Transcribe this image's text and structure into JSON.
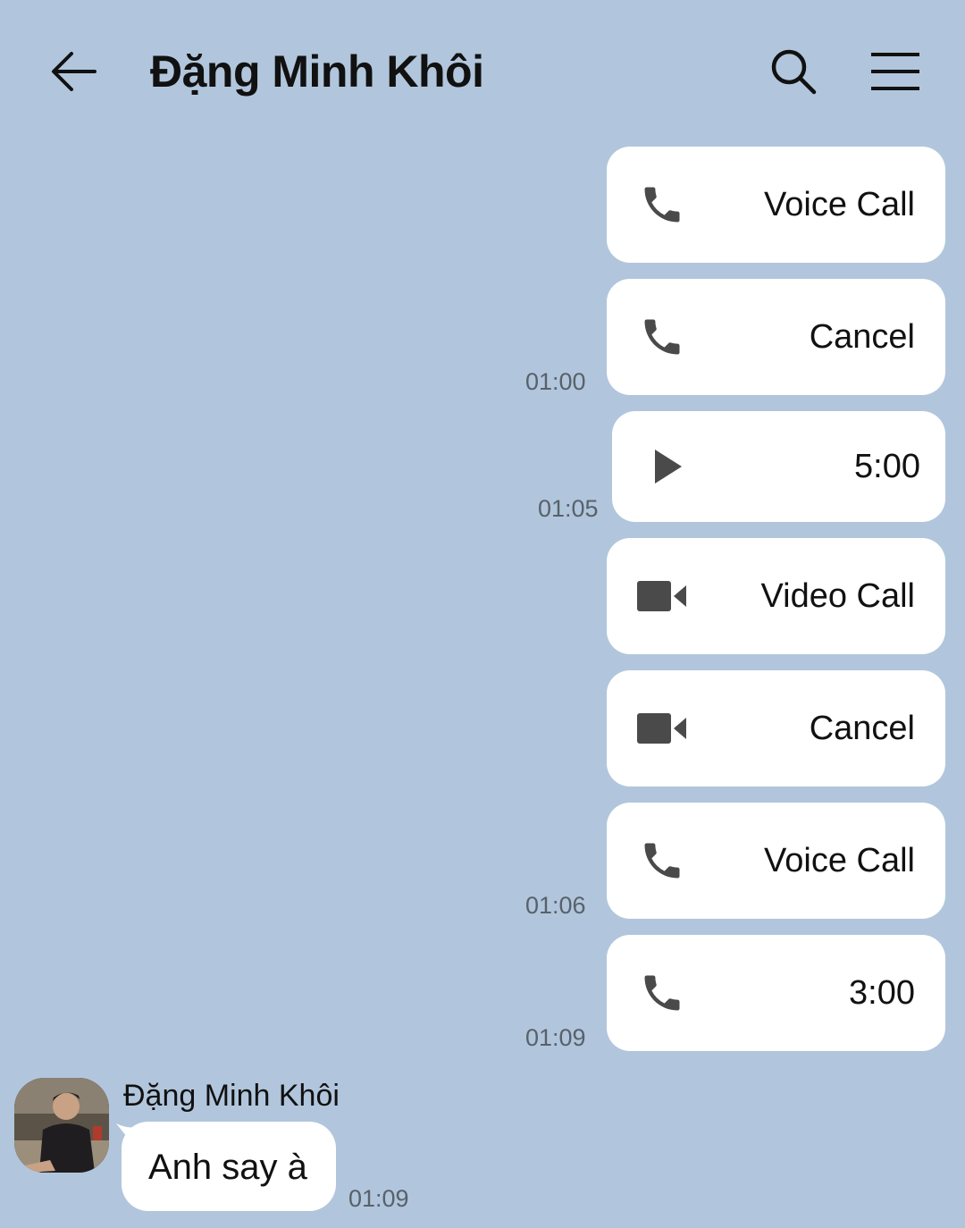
{
  "header": {
    "title": "Đặng Minh Khôi",
    "back_icon": "arrow-left-icon",
    "search_icon": "search-icon",
    "menu_icon": "menu-icon"
  },
  "messages": [
    {
      "icon": "phone-icon",
      "label": "Voice Call",
      "time": ""
    },
    {
      "icon": "phone-icon",
      "label": "Cancel",
      "time": "01:00"
    },
    {
      "icon": "play-icon",
      "label": "5:00",
      "time": "01:05"
    },
    {
      "icon": "video-camera-icon",
      "label": "Video Call",
      "time": ""
    },
    {
      "icon": "video-camera-icon",
      "label": "Cancel",
      "time": ""
    },
    {
      "icon": "phone-icon",
      "label": "Voice Call",
      "time": "01:06"
    },
    {
      "icon": "phone-icon",
      "label": "3:00",
      "time": "01:09"
    }
  ],
  "incoming": {
    "sender": "Đặng Minh Khôi",
    "text": "Anh say à",
    "time": "01:09"
  },
  "colors": {
    "background": "#b1c6dc",
    "bubble": "#ffffff",
    "icon": "#4a4a4a",
    "timestamp": "#58616b"
  }
}
